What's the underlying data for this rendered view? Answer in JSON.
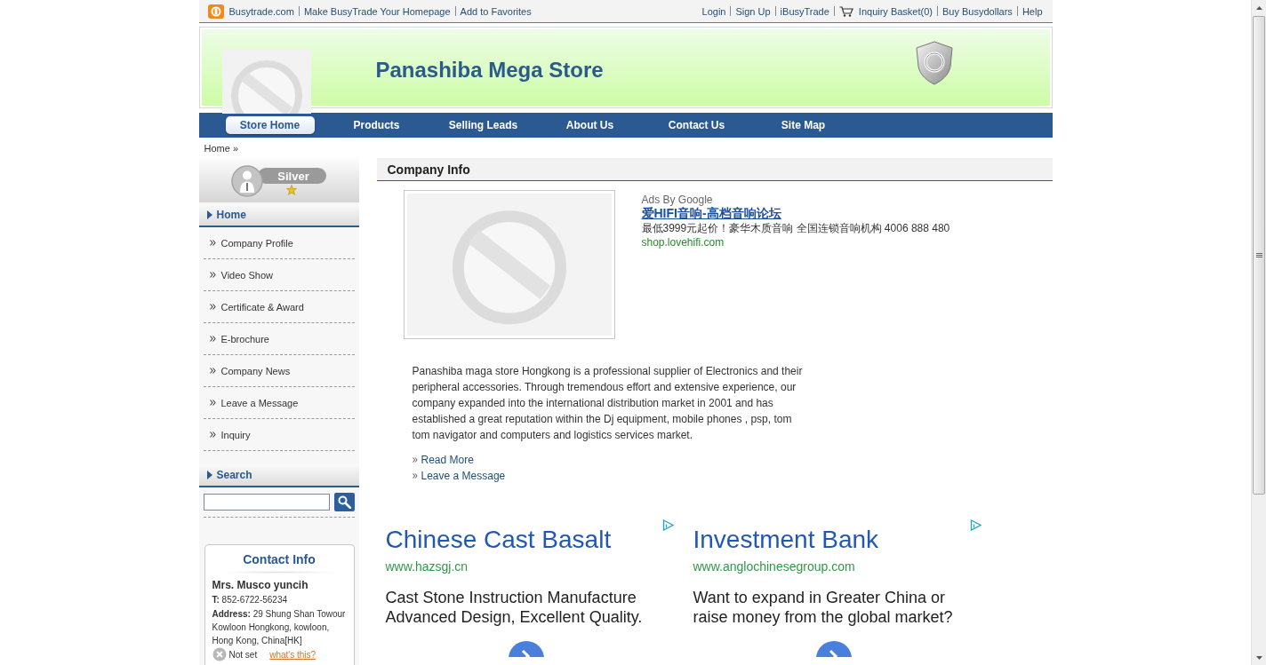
{
  "top_bar": {
    "left_links": [
      "Busytrade.com",
      "Make BusyTrade Your Homepage",
      "Add to Favorites"
    ],
    "right_links": [
      {
        "label": "Login",
        "kind": "link"
      },
      {
        "label": "Sign Up",
        "kind": "link"
      },
      {
        "label": "iBusyTrade",
        "kind": "link"
      },
      {
        "label": "Inquiry Basket(0)",
        "kind": "basket"
      },
      {
        "label": "Buy Busydollars",
        "kind": "link"
      },
      {
        "label": "Help",
        "kind": "link"
      }
    ]
  },
  "header": {
    "store_name": "Panashiba Mega Store"
  },
  "nav": [
    {
      "label": "Store Home",
      "selected": true
    },
    {
      "label": "Products",
      "selected": false
    },
    {
      "label": "Selling Leads",
      "selected": false
    },
    {
      "label": "About Us",
      "selected": false
    },
    {
      "label": "Contact Us",
      "selected": false
    },
    {
      "label": "Site Map",
      "selected": false
    }
  ],
  "breadcrumb": "Home »",
  "sidebar": {
    "membership": "Silver",
    "menu": {
      "title": "Home",
      "items": [
        "Company Profile",
        "Video Show",
        "Certificate & Award",
        "E-brochure",
        "Company News",
        "Leave a Message",
        "Inquiry"
      ]
    },
    "search": {
      "title": "Search"
    },
    "contact": {
      "title": "Contact Info",
      "name": "Mrs. Musco yuncih",
      "phone": "**T:** 852-6722-56234",
      "address": "**Address:** 29 Shung Shan Towour Kowloon Hongkong, kowloon, Hong Kong, China[HK]",
      "status": "Not set",
      "status_link": "what's this?"
    }
  },
  "main": {
    "section_title": "Company Info",
    "sponsored": {
      "label": "Ads By Google",
      "title": "爱HIFI音响-高档音响论坛",
      "description": "最低3999元起价！豪华木质音响 全国连锁音响机构 4006 888 480",
      "url": "shop.lovehifi.com"
    },
    "description": "Panashiba maga store Hongkong is a professional supplier of Electronics and their peripheral accessories. Through tremendous effort and extensive experience, our company expanded into the international distribution market in 2001 and has established a great reputation within the Dj equipment, mobile phones , psp, tom tom navigator and computers and logistics services market.",
    "links": [
      "Read More",
      "Leave a Message"
    ],
    "ads": [
      {
        "title": "Chinese Cast Basalt",
        "url": "www.hazsgj.cn",
        "description": "Cast Stone Instruction Manufacture Advanced Design, Excellent Quality."
      },
      {
        "title": "Investment Bank",
        "url": "www.anglochinesegroup.com",
        "description": "Want to expand in Greater China or raise money from the global market?"
      }
    ]
  }
}
